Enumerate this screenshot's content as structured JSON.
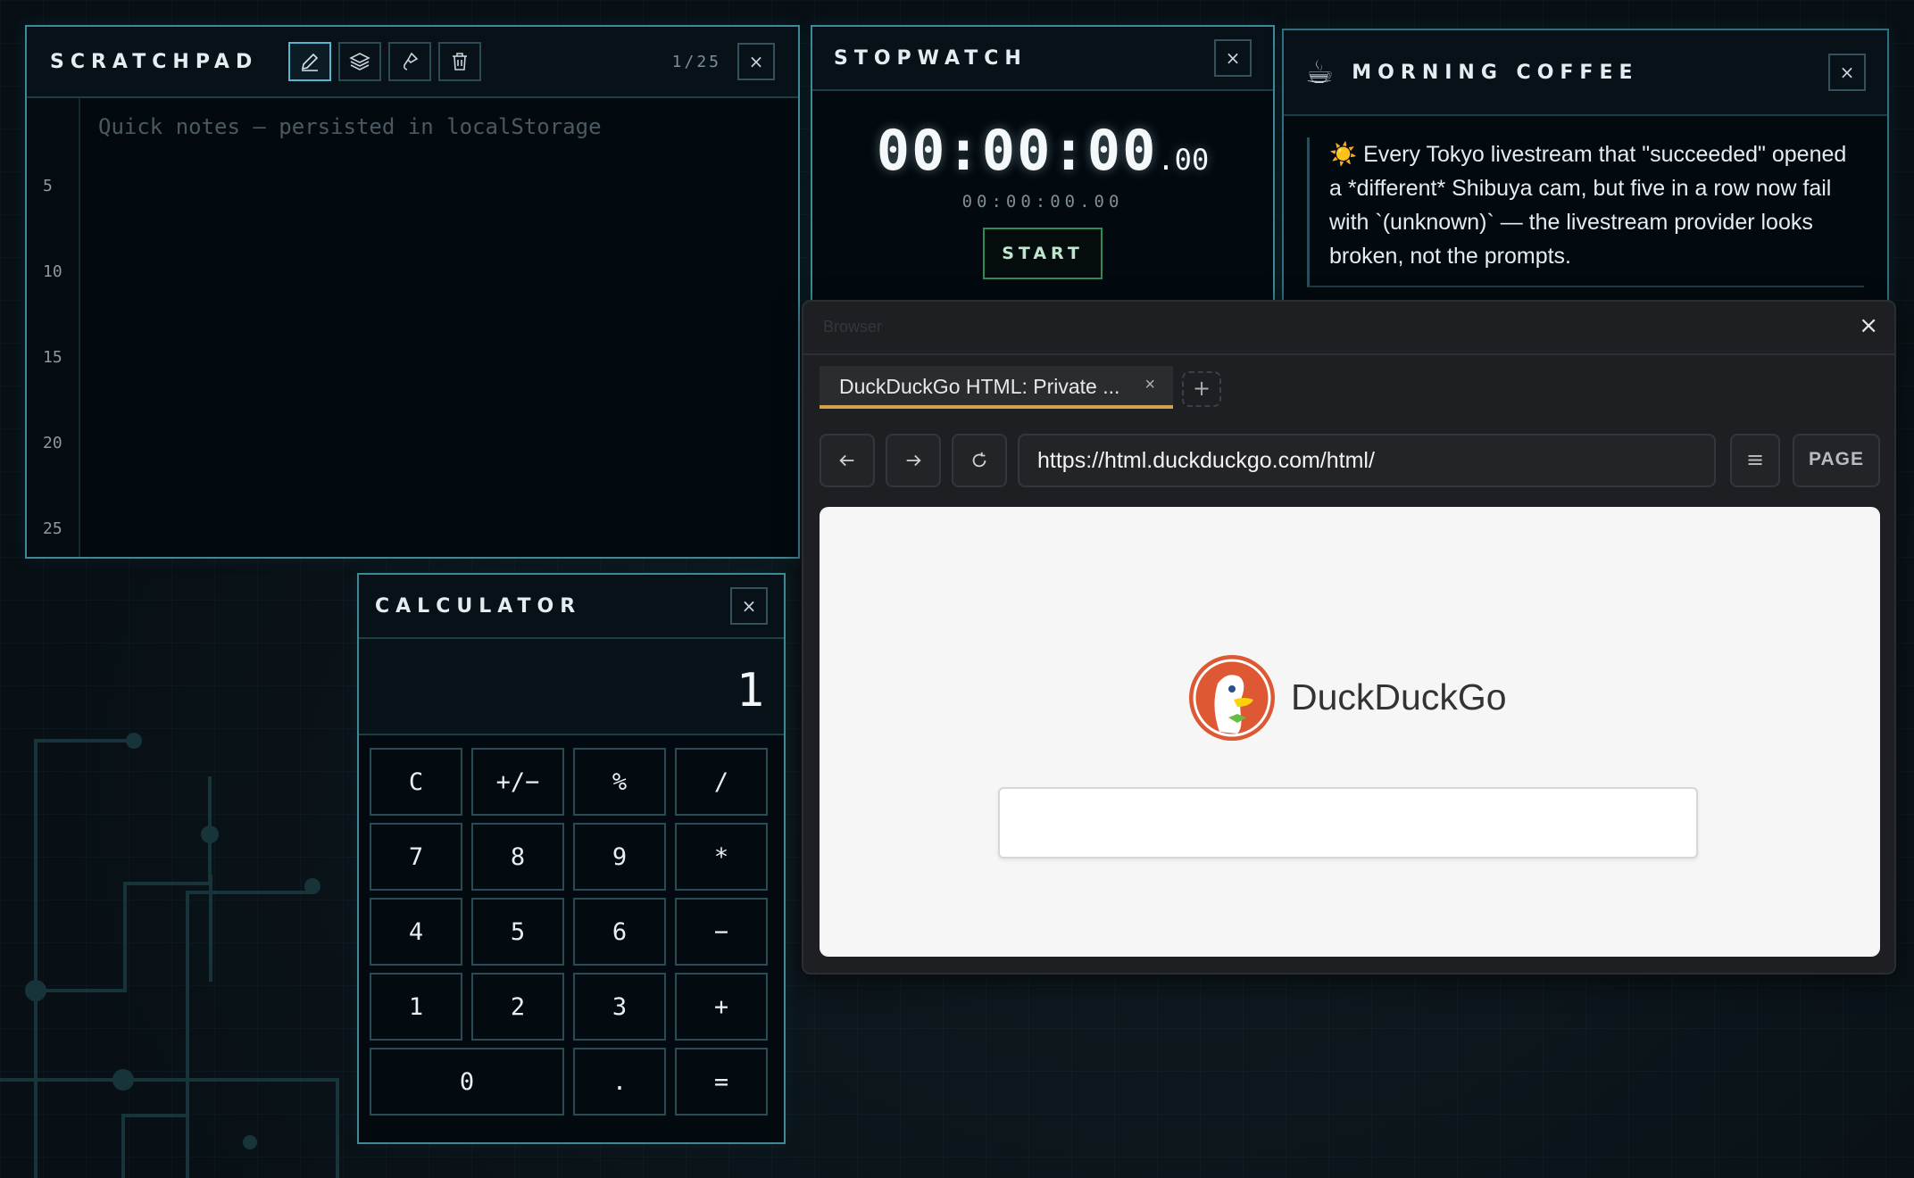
{
  "scratchpad": {
    "title": "SCRATCHPAD",
    "counter": "1/25",
    "placeholder": "Quick notes — persisted in localStorage",
    "line_numbers": [
      "5",
      "10",
      "15",
      "20",
      "25"
    ],
    "tools": [
      "pencil-icon",
      "layers-icon",
      "brush-icon",
      "trash-icon"
    ],
    "close": "×"
  },
  "stopwatch": {
    "title": "STOPWATCH",
    "main_time": "00:00:00",
    "main_ms": ".00",
    "sub_time": "00:00:00.00",
    "start_label": "START",
    "close": "×"
  },
  "coffee": {
    "title": "MORNING COFFEE",
    "icon": "☕",
    "message_icon": "☀️",
    "message": "Every Tokyo livestream that \"succeeded\" opened a *different* Shibuya cam, but five in a row now fail with `(unknown)` — the livestream provider looks broken, not the prompts.",
    "close": "×"
  },
  "browser": {
    "window_label": "Browser",
    "close": "×",
    "tab_title": "DuckDuckGo HTML: Private ...",
    "tab_close": "×",
    "new_tab": "+",
    "url": "https://html.duckduckgo.com/html/",
    "menu_icon": "≡",
    "page_label": "PAGE",
    "site_name": "DuckDuckGo",
    "search_value": "",
    "accent": "#d4a24c"
  },
  "calculator": {
    "title": "CALCULATOR",
    "display": "1",
    "close": "×",
    "keys": [
      "C",
      "+/−",
      "%",
      "/",
      "7",
      "8",
      "9",
      "*",
      "4",
      "5",
      "6",
      "−",
      "1",
      "2",
      "3",
      "+",
      "0",
      ".",
      "="
    ]
  }
}
